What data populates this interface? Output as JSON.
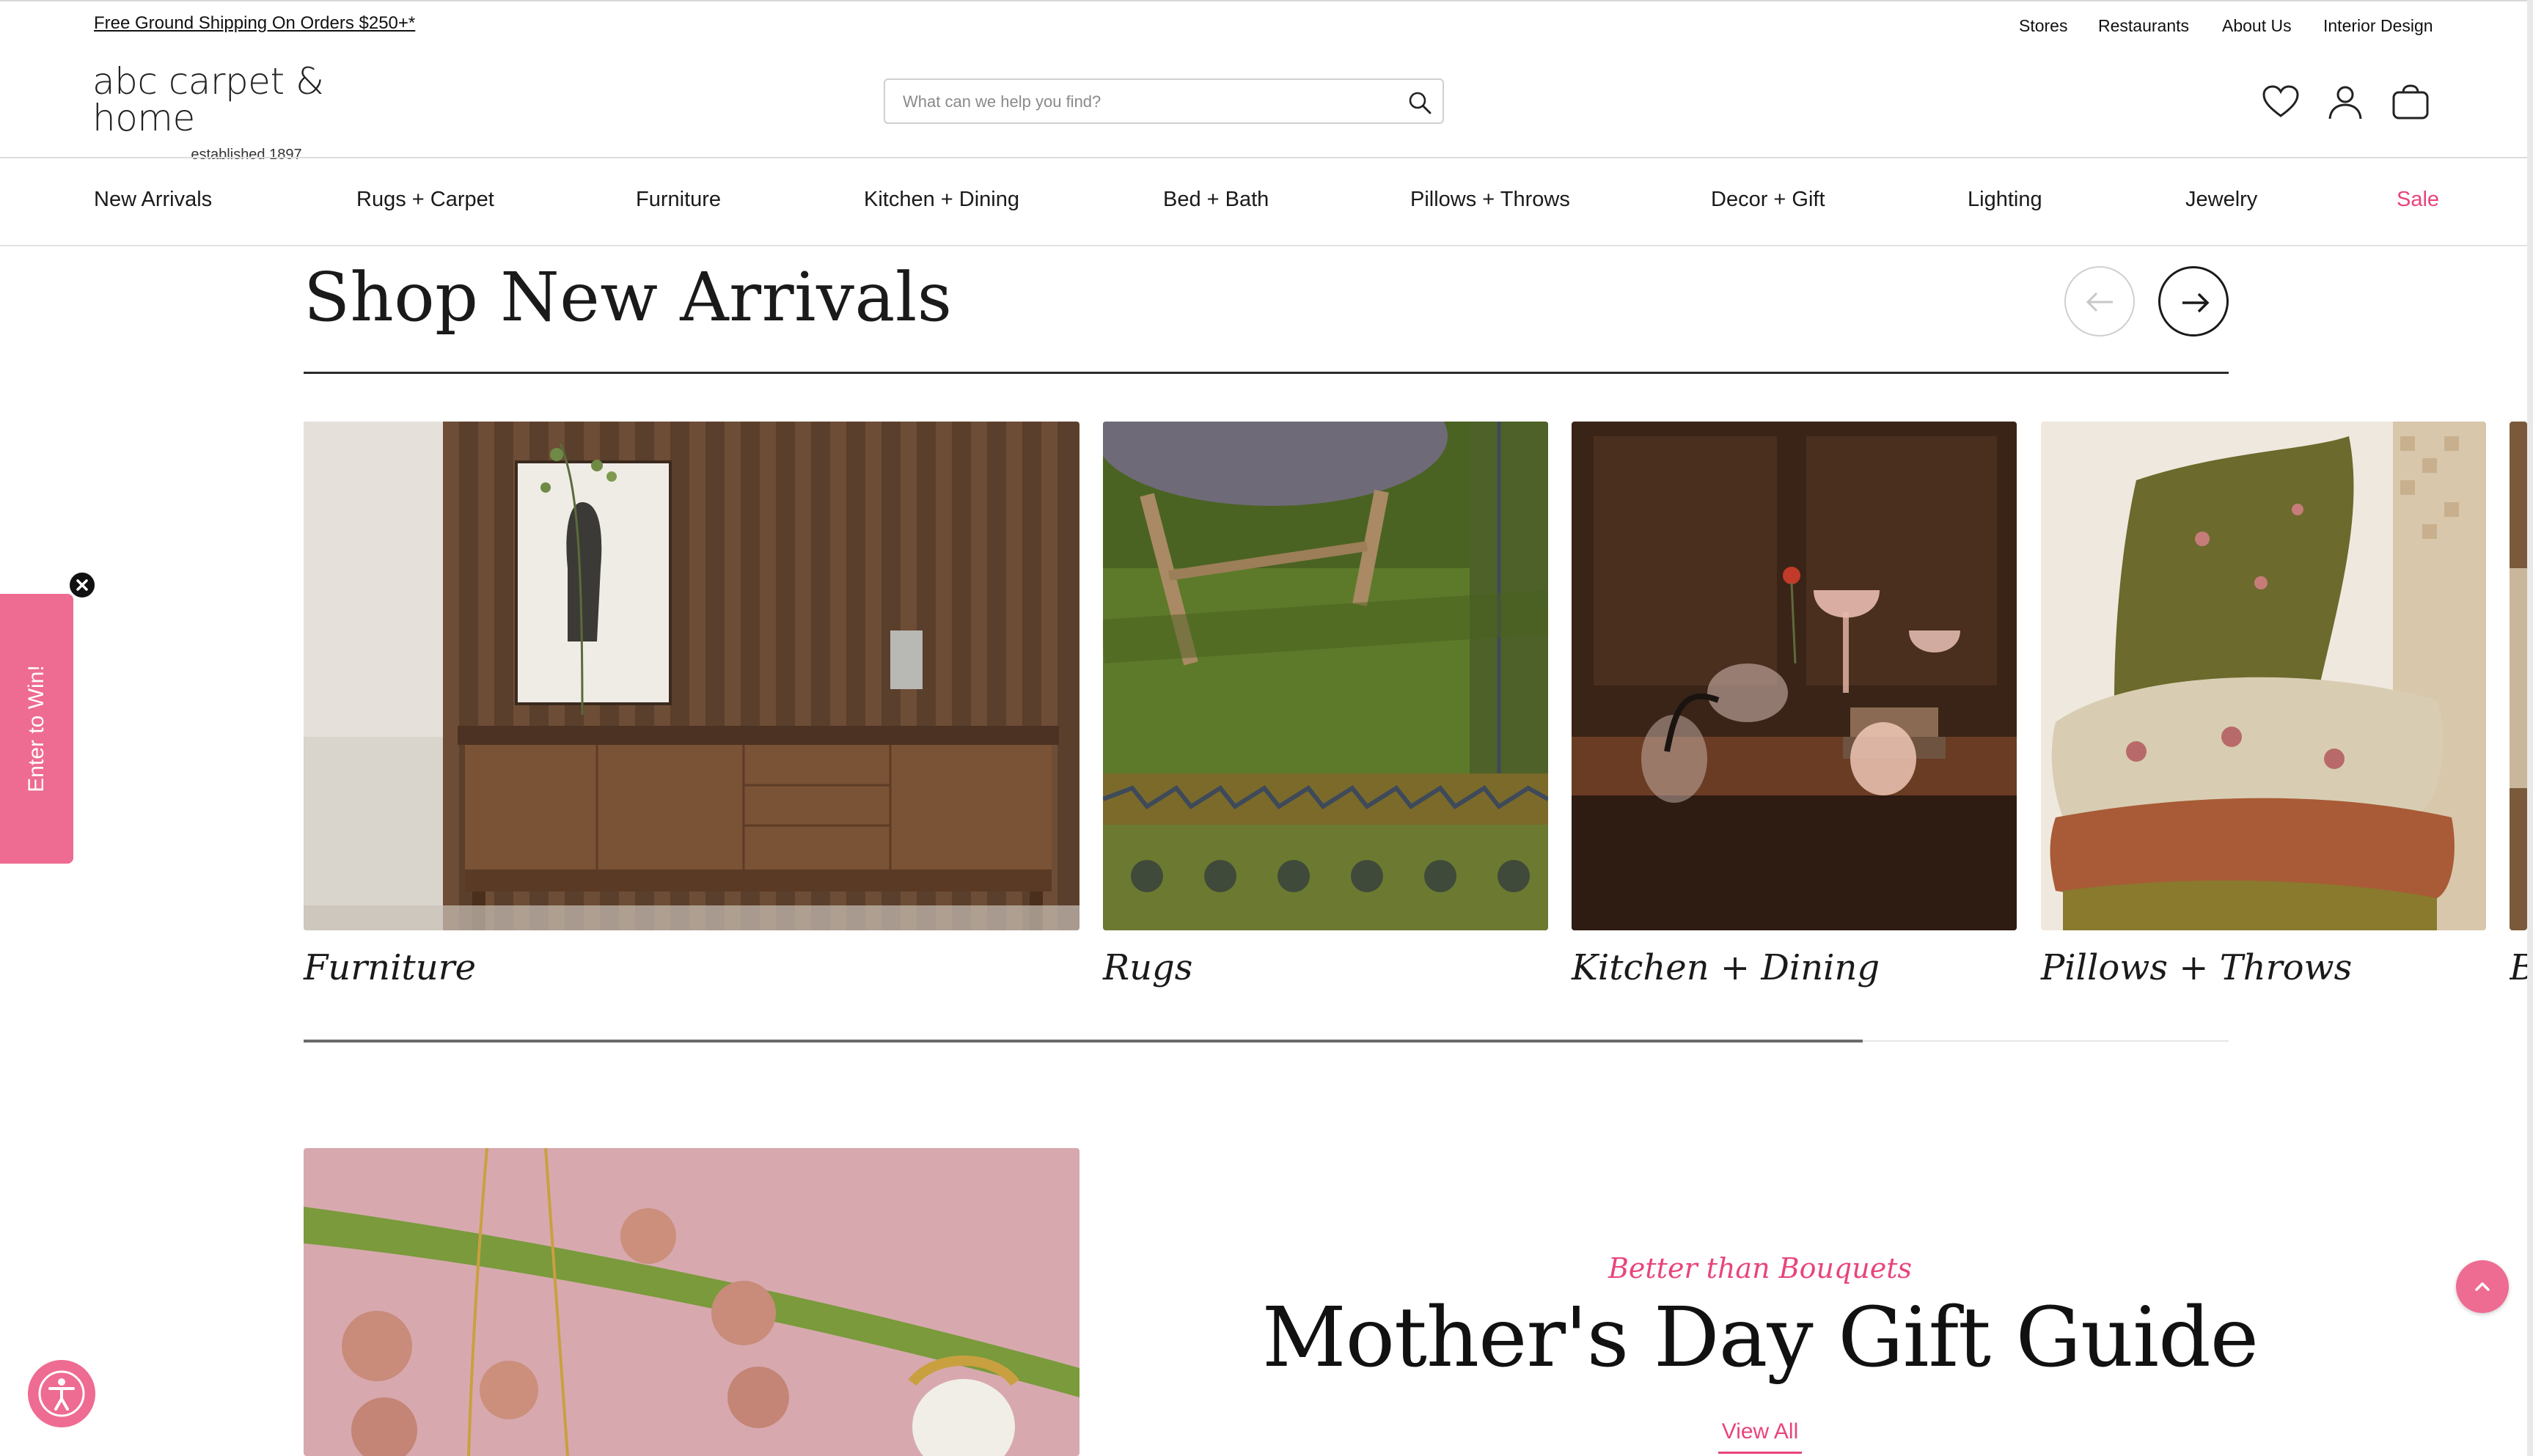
{
  "announcement": {
    "promo_text": "Free Ground Shipping On Orders $250+*"
  },
  "utility_nav": [
    "Stores",
    "Restaurants",
    "About Us",
    "Interior Design"
  ],
  "brand": {
    "name": "abc carpet & home",
    "tagline": "established 1897"
  },
  "search": {
    "placeholder": "What can we help you find?",
    "icon": "search-icon"
  },
  "header_icons": [
    "heart-icon",
    "user-icon",
    "bag-icon"
  ],
  "main_nav": [
    "New Arrivals",
    "Rugs + Carpet",
    "Furniture",
    "Kitchen + Dining",
    "Bed + Bath",
    "Pillows + Throws",
    "Decor + Gift",
    "Lighting",
    "Jewelry",
    "Sale"
  ],
  "colors": {
    "accent_pink": "#e8457a",
    "widget_pink": "#ee6b92",
    "text": "#1a1a1a"
  },
  "new_arrivals": {
    "title": "Shop New Arrivals",
    "prev_icon": "arrow-left-icon",
    "next_icon": "arrow-right-icon",
    "categories": [
      {
        "label": "Furniture"
      },
      {
        "label": "Rugs"
      },
      {
        "label": "Kitchen + Dining"
      },
      {
        "label": "Pillows + Throws"
      },
      {
        "label": "B"
      }
    ],
    "scroll_progress": 0.81
  },
  "gift_guide": {
    "eyebrow": "Better than Bouquets",
    "title": "Mother's Day Gift Guide",
    "link": "View All"
  },
  "widgets": {
    "enter_to_win": "Enter to Win!",
    "close_icon": "close-icon",
    "accessibility_icon": "accessibility-icon",
    "back_to_top_icon": "chevron-up-icon"
  }
}
